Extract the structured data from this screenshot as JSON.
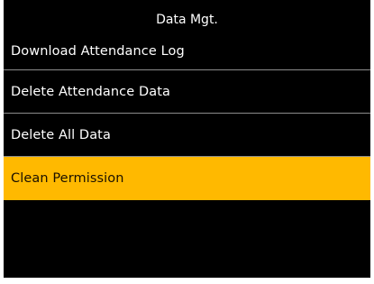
{
  "title": "Data Mgt.",
  "menu": {
    "items": [
      {
        "label": "Download Attendance Log",
        "selected": false
      },
      {
        "label": "Delete Attendance Data",
        "selected": false
      },
      {
        "label": "Delete All Data",
        "selected": false
      },
      {
        "label": "Clean Permission",
        "selected": true
      }
    ]
  },
  "colors": {
    "background": "#000000",
    "text": "#ffffff",
    "highlight": "#ffb900",
    "divider": "#8c8c8c"
  }
}
